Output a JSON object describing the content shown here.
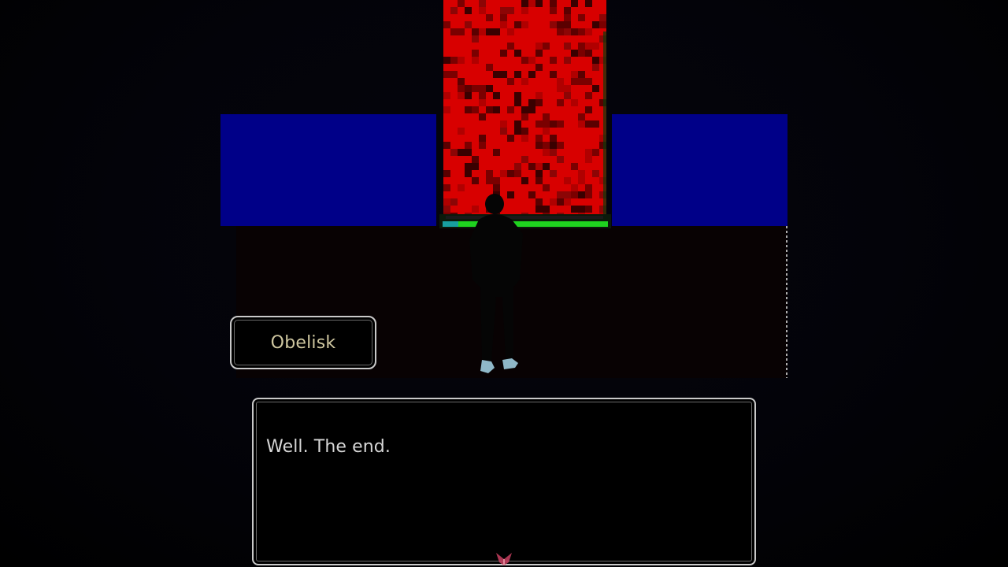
{
  "speaker": {
    "name": "Obelisk"
  },
  "dialogue": {
    "text": "Well. The end."
  },
  "colors": {
    "wall": "#000088",
    "pillar_red": "#d80000",
    "pillar_dark": "#6a0000",
    "base_green": "#1fd31f",
    "floor": "#080203",
    "figure": "#050505",
    "shoes": "#8fb8c8",
    "box_border": "#c9c9c9",
    "name_text": "#cfc7a0",
    "dialogue_text": "#d6d6d6",
    "advance_icon": "#c84060"
  },
  "icons": {
    "advance": "advance-indicator-icon"
  }
}
